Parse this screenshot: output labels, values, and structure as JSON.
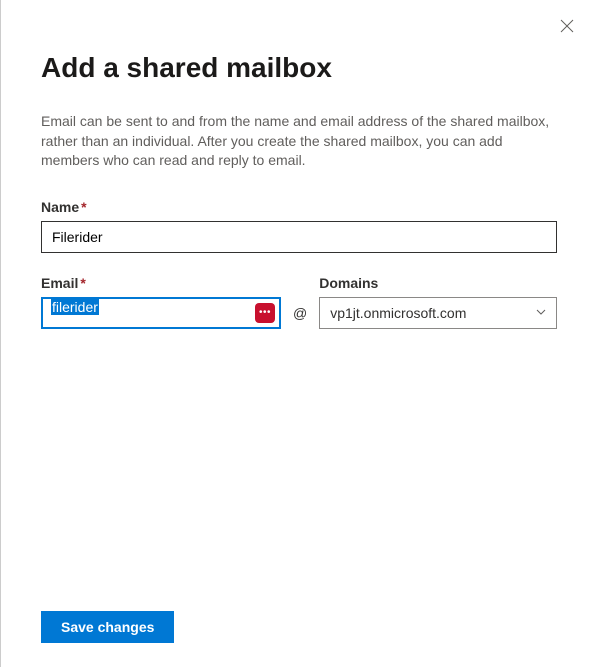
{
  "header": {
    "title": "Add a shared mailbox",
    "description": "Email can be sent to and from the name and email address of the shared mailbox, rather than an individual. After you create the shared mailbox, you can add members who can read and reply to email."
  },
  "form": {
    "name_label": "Name",
    "name_value": "Filerider",
    "email_label": "Email",
    "email_value": "filerider",
    "at_symbol": "@",
    "domains_label": "Domains",
    "domains_value": "vp1jt.onmicrosoft.com"
  },
  "footer": {
    "save_label": "Save changes"
  }
}
